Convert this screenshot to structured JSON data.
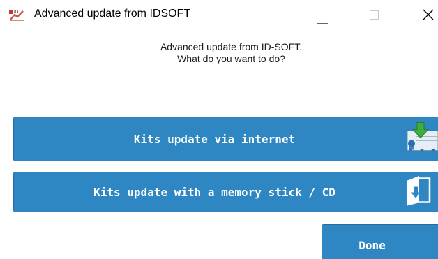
{
  "window": {
    "title": "Advanced update from IDSOFT",
    "app_icon": "idsoft-logo-icon",
    "controls": {
      "minimize": "minimize-icon",
      "maximize": "maximize-icon",
      "close": "close-icon"
    }
  },
  "prompt": {
    "line1": "Advanced update from ID-SOFT.",
    "line2": "What do you want to do?"
  },
  "actions": {
    "internet": {
      "label": "Kits update via internet",
      "icon": "download-update-icon"
    },
    "memory": {
      "label": "Kits update with a memory stick / CD",
      "icon": "folder-import-icon"
    },
    "done": {
      "label": "Done"
    }
  },
  "colors": {
    "button_blue": "#2e87c2",
    "button_border": "#236d9f",
    "button_text": "#ffffff"
  }
}
